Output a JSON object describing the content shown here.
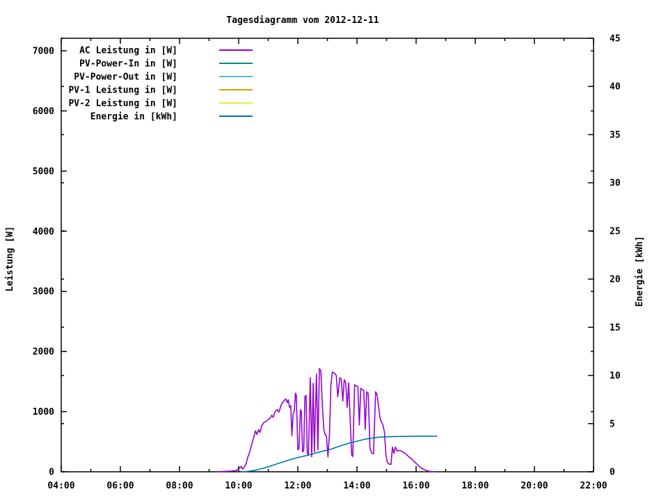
{
  "window": {
    "title": "Tagesdiagramm vom 2012-12-11"
  },
  "colors": {
    "background": "#ffffff",
    "foreground": "#000000"
  },
  "chart_data": {
    "type": "line",
    "title": "Tagesdiagramm vom 2012-12-11",
    "grid": false,
    "legend_position": "top-left",
    "x_axis": {
      "unit": "time",
      "range_hours": [
        4,
        22
      ],
      "major_tick_labels": [
        "04:00",
        "06:00",
        "08:00",
        "10:00",
        "12:00",
        "14:00",
        "16:00",
        "18:00",
        "20:00",
        "22:00"
      ],
      "major_tick_hours": [
        4,
        6,
        8,
        10,
        12,
        14,
        16,
        18,
        20,
        22
      ],
      "minor_tick_hours": [
        5,
        7,
        9,
        11,
        13,
        15,
        17,
        19,
        21
      ]
    },
    "y_axis_left": {
      "label": "Leistung [W]",
      "range": [
        0,
        7208
      ],
      "tick_values": [
        0,
        1000,
        2000,
        3000,
        4000,
        5000,
        6000,
        7000
      ],
      "tick_labels": [
        "0",
        "1000",
        "2000",
        "3000",
        "4000",
        "5000",
        "6000",
        "7000"
      ]
    },
    "y_axis_right": {
      "label": "Energie [kWh]",
      "range": [
        0,
        45
      ],
      "tick_values": [
        0,
        5,
        10,
        15,
        20,
        25,
        30,
        35,
        40,
        45
      ],
      "tick_labels": [
        "0",
        "5",
        "10",
        "15",
        "20",
        "25",
        "30",
        "35",
        "40",
        "45"
      ]
    },
    "series": [
      {
        "name": "AC Leistung in [W]",
        "color": "#9400D3",
        "axis": "left",
        "points": [
          [
            9.3,
            2
          ],
          [
            9.45,
            5
          ],
          [
            9.6,
            8
          ],
          [
            9.75,
            12
          ],
          [
            9.9,
            18
          ],
          [
            10.02,
            60
          ],
          [
            10.08,
            90
          ],
          [
            10.13,
            45
          ],
          [
            10.18,
            70
          ],
          [
            10.25,
            130
          ],
          [
            10.3,
            230
          ],
          [
            10.38,
            340
          ],
          [
            10.45,
            470
          ],
          [
            10.52,
            590
          ],
          [
            10.57,
            680
          ],
          [
            10.62,
            620
          ],
          [
            10.67,
            700
          ],
          [
            10.72,
            655
          ],
          [
            10.78,
            760
          ],
          [
            10.85,
            820
          ],
          [
            10.92,
            835
          ],
          [
            11.0,
            870
          ],
          [
            11.07,
            895
          ],
          [
            11.12,
            941
          ],
          [
            11.17,
            905
          ],
          [
            11.23,
            1000
          ],
          [
            11.3,
            1035
          ],
          [
            11.36,
            990
          ],
          [
            11.44,
            1117
          ],
          [
            11.52,
            1176
          ],
          [
            11.6,
            1211
          ],
          [
            11.64,
            1150
          ],
          [
            11.68,
            1195
          ],
          [
            11.72,
            1070
          ],
          [
            11.76,
            1100
          ],
          [
            11.8,
            600
          ],
          [
            11.84,
            953
          ],
          [
            11.88,
            1010
          ],
          [
            11.92,
            1306
          ],
          [
            11.95,
            1270
          ],
          [
            12.0,
            365
          ],
          [
            12.04,
            390
          ],
          [
            12.09,
            1035
          ],
          [
            12.12,
            1000
          ],
          [
            12.16,
            330
          ],
          [
            12.2,
            360
          ],
          [
            12.24,
            1247
          ],
          [
            12.28,
            1270
          ],
          [
            12.32,
            306
          ],
          [
            12.36,
            275
          ],
          [
            12.42,
            1564
          ],
          [
            12.47,
            250
          ],
          [
            12.52,
            1470
          ],
          [
            12.56,
            330
          ],
          [
            12.63,
            1623
          ],
          [
            12.68,
            365
          ],
          [
            12.73,
            1717
          ],
          [
            12.78,
            1680
          ],
          [
            12.83,
            1094
          ],
          [
            12.88,
            706
          ],
          [
            12.92,
            625
          ],
          [
            12.97,
            590
          ],
          [
            13.02,
            250
          ],
          [
            13.07,
            620
          ],
          [
            13.12,
            1447
          ],
          [
            13.17,
            1658
          ],
          [
            13.24,
            1640
          ],
          [
            13.3,
            1600
          ],
          [
            13.35,
            1247
          ],
          [
            13.42,
            1564
          ],
          [
            13.47,
            1541
          ],
          [
            13.52,
            1176
          ],
          [
            13.57,
            1529
          ],
          [
            13.62,
            1482
          ],
          [
            13.67,
            1070
          ],
          [
            13.72,
            1480
          ],
          [
            13.78,
            776
          ],
          [
            13.82,
            275
          ],
          [
            13.86,
            255
          ],
          [
            13.92,
            1447
          ],
          [
            13.97,
            1430
          ],
          [
            14.03,
            1411
          ],
          [
            14.08,
            776
          ],
          [
            14.13,
            1388
          ],
          [
            14.18,
            1368
          ],
          [
            14.23,
            1352
          ],
          [
            14.28,
            706
          ],
          [
            14.33,
            1329
          ],
          [
            14.38,
            1305
          ],
          [
            14.44,
            390
          ],
          [
            14.5,
            310
          ],
          [
            14.56,
            300
          ],
          [
            14.63,
            1329
          ],
          [
            14.68,
            1285
          ],
          [
            14.73,
            1094
          ],
          [
            14.78,
            894
          ],
          [
            14.83,
            823
          ],
          [
            14.88,
            776
          ],
          [
            14.93,
            660
          ],
          [
            14.98,
            272
          ],
          [
            15.03,
            155
          ],
          [
            15.08,
            130
          ],
          [
            15.15,
            122
          ],
          [
            15.2,
            412
          ],
          [
            15.25,
            305
          ],
          [
            15.3,
            412
          ],
          [
            15.36,
            345
          ],
          [
            15.45,
            355
          ],
          [
            15.55,
            332
          ],
          [
            15.65,
            296
          ],
          [
            15.75,
            252
          ],
          [
            15.85,
            213
          ],
          [
            15.95,
            162
          ],
          [
            16.05,
            118
          ],
          [
            16.15,
            72
          ],
          [
            16.25,
            42
          ],
          [
            16.35,
            20
          ],
          [
            16.45,
            8
          ],
          [
            16.55,
            3
          ],
          [
            16.67,
            1
          ]
        ]
      },
      {
        "name": "PV-Power-In in [W]",
        "color": "#009173",
        "axis": "left",
        "points": []
      },
      {
        "name": "PV-Power-Out in [W]",
        "color": "#56B4E9",
        "axis": "left",
        "points": []
      },
      {
        "name": "PV-1 Leistung in [W]",
        "color": "#E69F00",
        "axis": "left",
        "points": []
      },
      {
        "name": "PV-2 Leistung in [W]",
        "color": "#F0E442",
        "axis": "left",
        "points": []
      },
      {
        "name": "Energie in [kWh]",
        "color": "#0072B2",
        "axis": "right",
        "points": [
          [
            10.1,
            0
          ],
          [
            10.3,
            0.04
          ],
          [
            10.5,
            0.12
          ],
          [
            10.7,
            0.26
          ],
          [
            10.9,
            0.42
          ],
          [
            11.1,
            0.62
          ],
          [
            11.3,
            0.83
          ],
          [
            11.5,
            1.02
          ],
          [
            11.7,
            1.22
          ],
          [
            11.9,
            1.4
          ],
          [
            12.1,
            1.55
          ],
          [
            12.3,
            1.68
          ],
          [
            12.5,
            1.85
          ],
          [
            12.7,
            2.02
          ],
          [
            12.9,
            2.18
          ],
          [
            13.1,
            2.32
          ],
          [
            13.3,
            2.55
          ],
          [
            13.5,
            2.75
          ],
          [
            13.7,
            2.95
          ],
          [
            13.9,
            3.1
          ],
          [
            14.1,
            3.25
          ],
          [
            14.3,
            3.4
          ],
          [
            14.5,
            3.48
          ],
          [
            14.7,
            3.58
          ],
          [
            14.9,
            3.62
          ],
          [
            15.1,
            3.64
          ],
          [
            15.35,
            3.66
          ],
          [
            15.6,
            3.67
          ],
          [
            15.85,
            3.68
          ],
          [
            16.1,
            3.7
          ],
          [
            16.7,
            3.7
          ]
        ]
      }
    ]
  }
}
